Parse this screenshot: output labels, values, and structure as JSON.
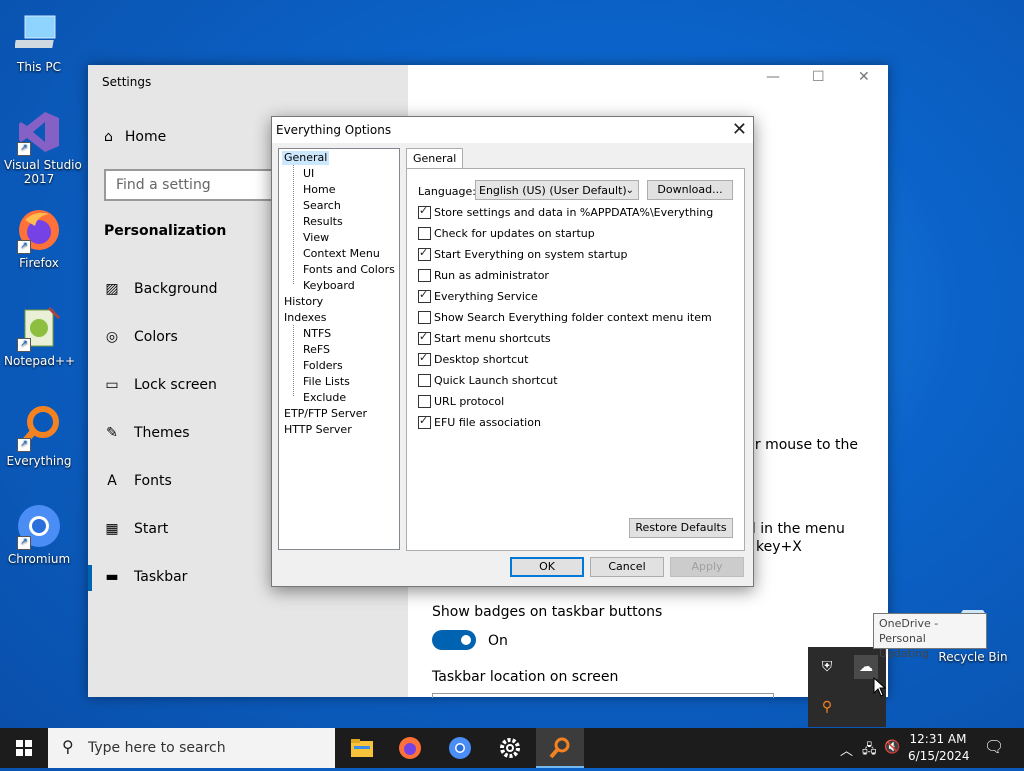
{
  "desktop": {
    "icons": [
      {
        "label": "This PC"
      },
      {
        "label": "Visual Studio\n2017"
      },
      {
        "label": "Firefox"
      },
      {
        "label": "Notepad++"
      },
      {
        "label": "Everything"
      },
      {
        "label": "Chromium"
      },
      {
        "label": "Recycle Bin"
      }
    ]
  },
  "settings": {
    "title": "Settings",
    "home": "Home",
    "search_placeholder": "Find a setting",
    "section": "Personalization",
    "nav": [
      "Background",
      "Colors",
      "Lock screen",
      "Themes",
      "Fonts",
      "Start",
      "Taskbar"
    ],
    "selected_nav": "Taskbar",
    "right": {
      "partial1": "ur mouse to the",
      "partial2": "ll in the menu",
      "partial3": "key+X",
      "badges_label": "Show badges on taskbar buttons",
      "badges_state": "On",
      "location_label": "Taskbar location on screen"
    }
  },
  "dialog": {
    "title": "Everything Options",
    "tree": [
      "General",
      "UI",
      "Home",
      "Search",
      "Results",
      "View",
      "Context Menu",
      "Fonts and Colors",
      "Keyboard",
      "History",
      "Indexes",
      "NTFS",
      "ReFS",
      "Folders",
      "File Lists",
      "Exclude",
      "ETP/FTP Server",
      "HTTP Server"
    ],
    "tab": "General",
    "language_label": "Language:",
    "language_value": "English (US) (User Default)",
    "download_button": "Download...",
    "options": [
      {
        "label": "Store settings and data in %APPDATA%\\Everything",
        "checked": true
      },
      {
        "label": "Check for updates on startup",
        "checked": false
      },
      {
        "label": "Start Everything on system startup",
        "checked": true
      },
      {
        "label": "Run as administrator",
        "checked": false
      },
      {
        "label": "Everything Service",
        "checked": true
      },
      {
        "label": "Show Search Everything folder context menu item",
        "checked": false
      },
      {
        "label": "Start menu shortcuts",
        "checked": true
      },
      {
        "label": "Desktop shortcut",
        "checked": true
      },
      {
        "label": "Quick Launch shortcut",
        "checked": false
      },
      {
        "label": "URL protocol",
        "checked": false
      },
      {
        "label": "EFU file association",
        "checked": true
      }
    ],
    "restore_button": "Restore Defaults",
    "ok_button": "OK",
    "cancel_button": "Cancel",
    "apply_button": "Apply"
  },
  "tooltip": {
    "line1": "OneDrive - Personal",
    "line2": "Updating"
  },
  "taskbar": {
    "search_placeholder": "Type here to search",
    "time": "12:31 AM",
    "date": "6/15/2024"
  },
  "colors": {
    "accent": "#0063b1",
    "taskbar": "#1c1c1c"
  }
}
